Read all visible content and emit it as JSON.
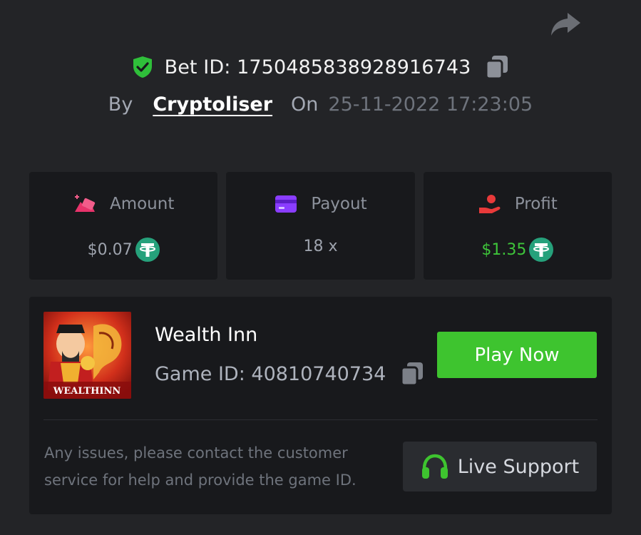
{
  "bet": {
    "id_text": "Bet ID: 17504858389289167 43",
    "by_label": "By",
    "author": "Cryptoliser",
    "on_label": "On",
    "date": "25-11-2022 17:23:05"
  },
  "stats": {
    "amount": {
      "label": "Amount",
      "value": "$0.07",
      "currency_icon": "usdt-tether-icon"
    },
    "payout": {
      "label": "Payout",
      "value": "18 x"
    },
    "profit": {
      "label": "Profit",
      "value": "$1.35",
      "currency_icon": "usdt-tether-icon"
    }
  },
  "game": {
    "title": "Wealth Inn",
    "game_id_text": "Game ID: 40810740734",
    "thumbnail_logo_text": "WEALTHINN",
    "play_label": "Play Now"
  },
  "support": {
    "help_text": "Any issues, please contact the customer service for help and provide the game ID.",
    "button_label": "Live Support"
  },
  "colors": {
    "background": "#232427",
    "card": "#18191c",
    "accent_green": "#3ec42f",
    "profit_green": "#3ec43a",
    "amount_icon": "#e8336b",
    "payout_icon": "#8a3dff",
    "profit_icon": "#e83a3a",
    "usdt": "#26a17b"
  }
}
